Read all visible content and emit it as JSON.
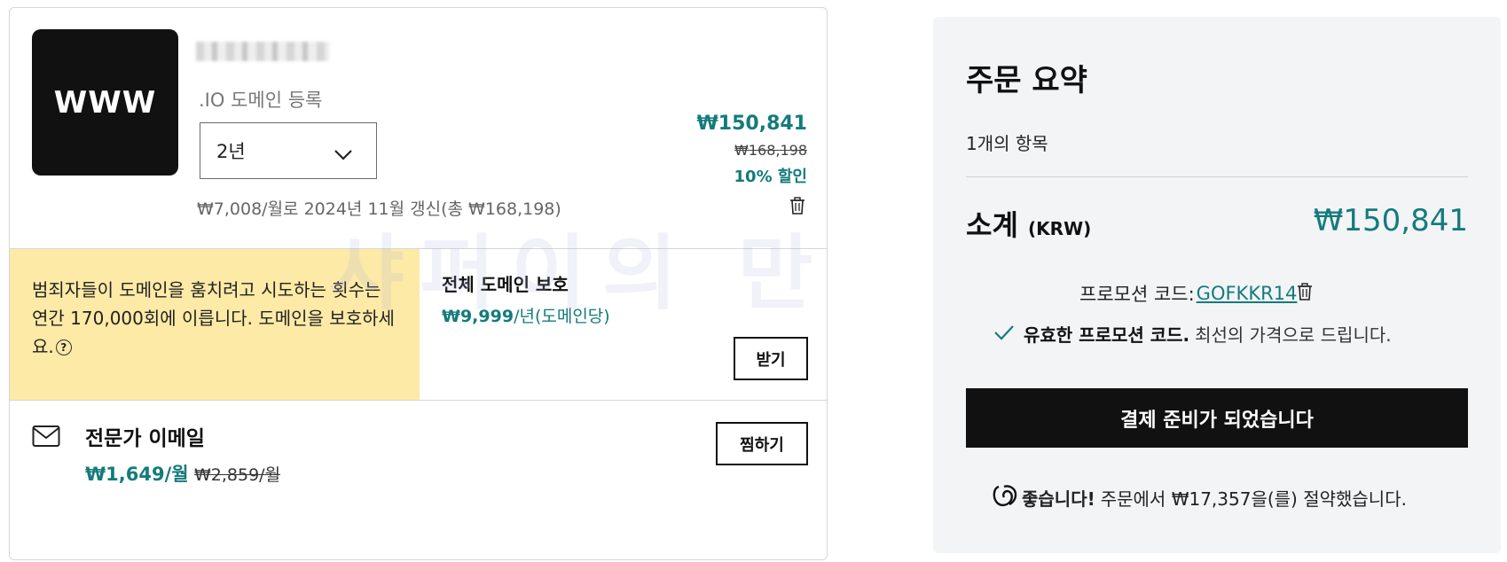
{
  "cart_item": {
    "logo_text": "WWW",
    "product_subtitle": ".IO 도메인 등록",
    "term_value": "2년",
    "renewal_text": "₩7,008/월로 2024년 11월 갱신(총 ₩168,198)",
    "price": "₩150,841",
    "original_price": "₩168,198",
    "discount": "10% 할인"
  },
  "protection_offer": {
    "warning_text": "범죄자들이 도메인을 훔치려고 시도하는 횟수는 연간 170,000회에 이릅니다. 도메인을 보호하세요.",
    "title": "전체 도메인 보호",
    "price_bold": "₩9,999",
    "price_suffix": "/년(도메인당)",
    "button_label": "받기"
  },
  "email_offer": {
    "title": "전문가 이메일",
    "price": "₩1,649/월",
    "original_price": "₩2,859/월",
    "button_label": "찜하기"
  },
  "watermark": "샤퍼이의 만물상",
  "order_summary": {
    "title": "주문 요약",
    "item_count": "1개의 항목",
    "subtotal_label": "소계",
    "currency": "(KRW)",
    "subtotal_value": "₩150,841",
    "promo_label": "프로모션 코드:",
    "promo_code": "GOFKKR14",
    "valid_bold": "유효한 프로모션 코드.",
    "valid_rest": "최선의 가격으로 드립니다.",
    "checkout_label": "결제 준비가 되었습니다",
    "saved_bold": "좋습니다!",
    "saved_rest": "주문에서 ₩17,357을(를) 절약했습니다."
  },
  "colors": {
    "accent": "#147b7c",
    "warning_bg": "#fdeaa6",
    "summary_bg": "#f3f4f6",
    "button_dark": "#111111"
  },
  "icons": [
    "chevron-down-icon",
    "trash-icon",
    "help-icon",
    "mail-icon",
    "check-icon",
    "godaddy-logo-icon"
  ]
}
